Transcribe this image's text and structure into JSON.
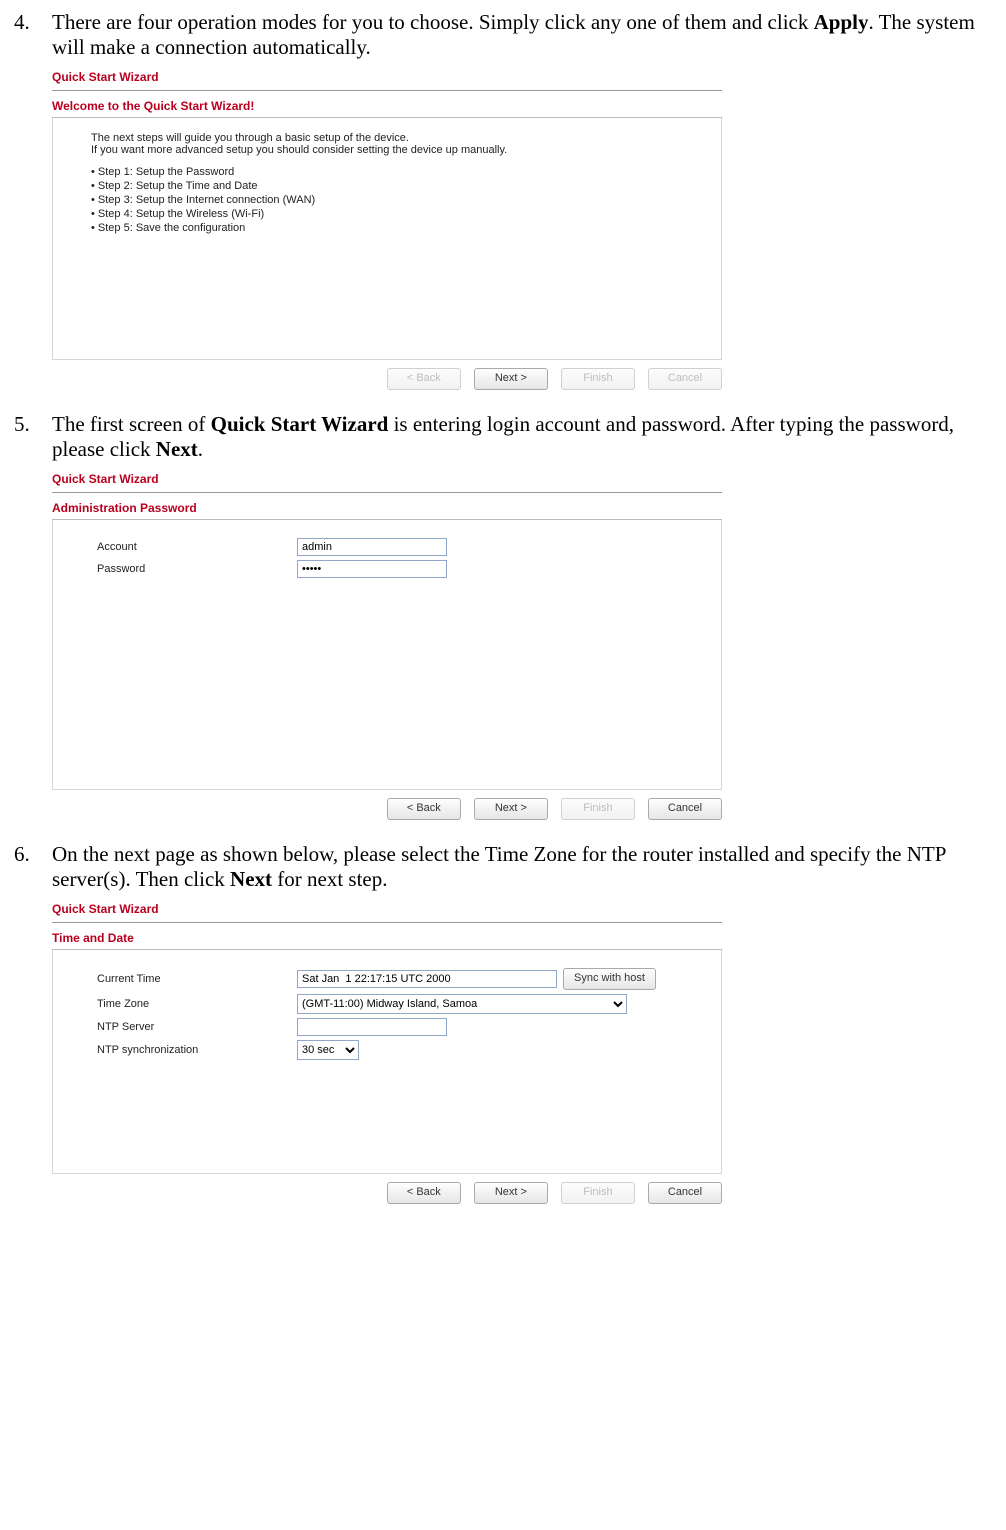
{
  "step4": {
    "number": "4.",
    "text_a": "There are four operation modes for you to choose. Simply click any one of them and click ",
    "bold": "Apply",
    "text_b": ". The system will make a connection automatically."
  },
  "shot1": {
    "wizard_title": "Quick Start Wizard",
    "subtitle": "Welcome to the Quick Start Wizard!",
    "intro1": "The next steps will guide you through a basic setup of the device.",
    "intro2": "If you want more advanced setup you should consider setting the device up manually.",
    "items": [
      "• Step 1: Setup the Password",
      "• Step 2: Setup the Time and Date",
      "• Step 3: Setup the Internet connection (WAN)",
      "• Step 4: Setup the Wireless (Wi-Fi)",
      "• Step 5: Save the configuration"
    ],
    "btn_back": "< Back",
    "btn_next": "Next >",
    "btn_finish": "Finish",
    "btn_cancel": "Cancel"
  },
  "step5": {
    "number": "5.",
    "text_a": "The first screen of ",
    "bold1": "Quick Start Wizard",
    "text_b": " is entering login account and password. After typing the password, please click ",
    "bold2": "Next",
    "text_c": "."
  },
  "shot2": {
    "wizard_title": "Quick Start Wizard",
    "subtitle": "Administration Password",
    "account_label": "Account",
    "account_value": "admin",
    "password_label": "Password",
    "password_value": "•••••",
    "btn_back": "< Back",
    "btn_next": "Next >",
    "btn_finish": "Finish",
    "btn_cancel": "Cancel"
  },
  "step6": {
    "number": "6.",
    "text_a": "On the next page as shown below, please select the Time Zone for the router installed and specify the NTP server(s). Then click ",
    "bold": "Next",
    "text_b": " for next step."
  },
  "shot3": {
    "wizard_title": "Quick Start Wizard",
    "subtitle": "Time and Date",
    "curtime_label": "Current Time",
    "curtime_value": "Sat Jan  1 22:17:15 UTC 2000",
    "sync_btn": "Sync with host",
    "tz_label": "Time Zone",
    "tz_value": "(GMT-11:00) Midway Island, Samoa",
    "ntp_label": "NTP Server",
    "ntp_value": "",
    "ntpsync_label": "NTP synchronization",
    "ntpsync_value": "30 sec",
    "btn_back": "< Back",
    "btn_next": "Next >",
    "btn_finish": "Finish",
    "btn_cancel": "Cancel"
  }
}
